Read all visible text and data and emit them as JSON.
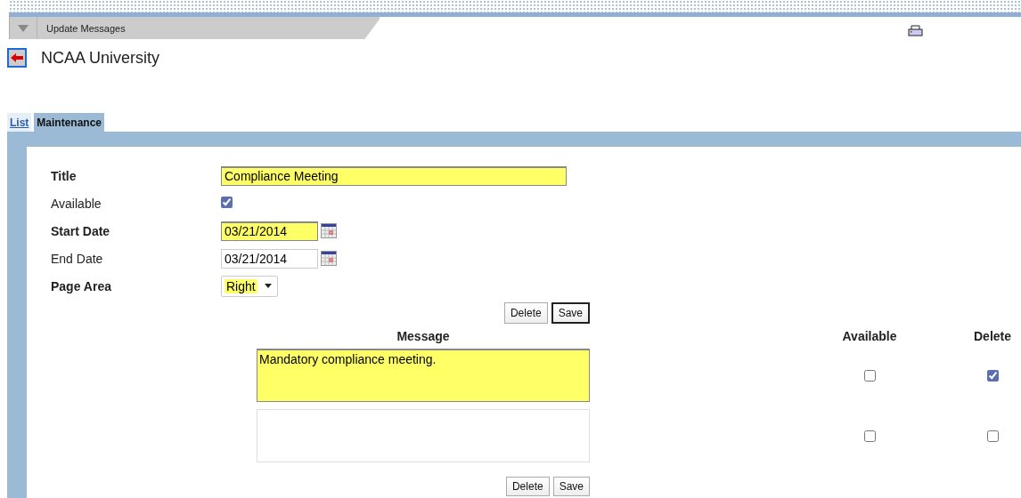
{
  "header": {
    "title": "Update Messages"
  },
  "organization": "NCAA University",
  "tabs": [
    {
      "label": "List",
      "selected": false
    },
    {
      "label": "Maintenance",
      "selected": true
    }
  ],
  "fields": [
    {
      "kind": "text",
      "label": "Title",
      "required": true,
      "value": "Compliance Meeting"
    },
    {
      "kind": "checkbox",
      "label": "Available",
      "required": false,
      "checked": true
    },
    {
      "kind": "date",
      "label": "Start Date",
      "required": true,
      "value": "03/21/2014"
    },
    {
      "kind": "date",
      "label": "End Date",
      "required": false,
      "value": "03/21/2014"
    },
    {
      "kind": "select",
      "label": "Page Area",
      "required": true,
      "value": "Right"
    }
  ],
  "top_buttons": [
    {
      "label": "Delete",
      "focused": false
    },
    {
      "label": "Save",
      "focused": true
    }
  ],
  "message_table": {
    "columns": [
      "Message",
      "Available",
      "Delete"
    ],
    "rows": [
      {
        "message": "Mandatory compliance meeting.",
        "required": true,
        "available": false,
        "delete": true
      },
      {
        "required": false,
        "available": false,
        "delete": false
      }
    ]
  },
  "bottom_buttons": [
    {
      "label": "Delete",
      "focused": false
    },
    {
      "label": "Save",
      "focused": false
    }
  ]
}
